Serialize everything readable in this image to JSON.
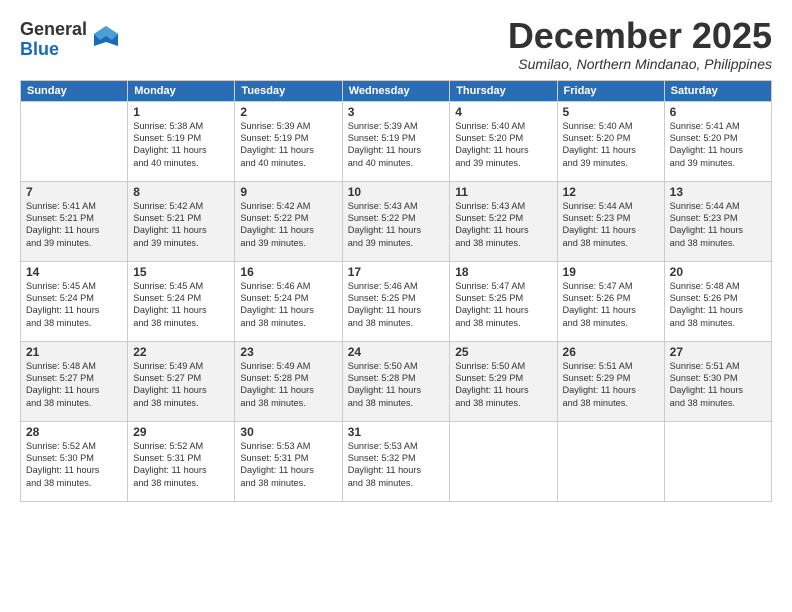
{
  "header": {
    "logo_line1": "General",
    "logo_line2": "Blue",
    "month": "December 2025",
    "location": "Sumilao, Northern Mindanao, Philippines"
  },
  "days_of_week": [
    "Sunday",
    "Monday",
    "Tuesday",
    "Wednesday",
    "Thursday",
    "Friday",
    "Saturday"
  ],
  "weeks": [
    [
      {
        "day": "",
        "info": ""
      },
      {
        "day": "1",
        "info": "Sunrise: 5:38 AM\nSunset: 5:19 PM\nDaylight: 11 hours\nand 40 minutes."
      },
      {
        "day": "2",
        "info": "Sunrise: 5:39 AM\nSunset: 5:19 PM\nDaylight: 11 hours\nand 40 minutes."
      },
      {
        "day": "3",
        "info": "Sunrise: 5:39 AM\nSunset: 5:19 PM\nDaylight: 11 hours\nand 40 minutes."
      },
      {
        "day": "4",
        "info": "Sunrise: 5:40 AM\nSunset: 5:20 PM\nDaylight: 11 hours\nand 39 minutes."
      },
      {
        "day": "5",
        "info": "Sunrise: 5:40 AM\nSunset: 5:20 PM\nDaylight: 11 hours\nand 39 minutes."
      },
      {
        "day": "6",
        "info": "Sunrise: 5:41 AM\nSunset: 5:20 PM\nDaylight: 11 hours\nand 39 minutes."
      }
    ],
    [
      {
        "day": "7",
        "info": "Sunrise: 5:41 AM\nSunset: 5:21 PM\nDaylight: 11 hours\nand 39 minutes."
      },
      {
        "day": "8",
        "info": "Sunrise: 5:42 AM\nSunset: 5:21 PM\nDaylight: 11 hours\nand 39 minutes."
      },
      {
        "day": "9",
        "info": "Sunrise: 5:42 AM\nSunset: 5:22 PM\nDaylight: 11 hours\nand 39 minutes."
      },
      {
        "day": "10",
        "info": "Sunrise: 5:43 AM\nSunset: 5:22 PM\nDaylight: 11 hours\nand 39 minutes."
      },
      {
        "day": "11",
        "info": "Sunrise: 5:43 AM\nSunset: 5:22 PM\nDaylight: 11 hours\nand 38 minutes."
      },
      {
        "day": "12",
        "info": "Sunrise: 5:44 AM\nSunset: 5:23 PM\nDaylight: 11 hours\nand 38 minutes."
      },
      {
        "day": "13",
        "info": "Sunrise: 5:44 AM\nSunset: 5:23 PM\nDaylight: 11 hours\nand 38 minutes."
      }
    ],
    [
      {
        "day": "14",
        "info": "Sunrise: 5:45 AM\nSunset: 5:24 PM\nDaylight: 11 hours\nand 38 minutes."
      },
      {
        "day": "15",
        "info": "Sunrise: 5:45 AM\nSunset: 5:24 PM\nDaylight: 11 hours\nand 38 minutes."
      },
      {
        "day": "16",
        "info": "Sunrise: 5:46 AM\nSunset: 5:24 PM\nDaylight: 11 hours\nand 38 minutes."
      },
      {
        "day": "17",
        "info": "Sunrise: 5:46 AM\nSunset: 5:25 PM\nDaylight: 11 hours\nand 38 minutes."
      },
      {
        "day": "18",
        "info": "Sunrise: 5:47 AM\nSunset: 5:25 PM\nDaylight: 11 hours\nand 38 minutes."
      },
      {
        "day": "19",
        "info": "Sunrise: 5:47 AM\nSunset: 5:26 PM\nDaylight: 11 hours\nand 38 minutes."
      },
      {
        "day": "20",
        "info": "Sunrise: 5:48 AM\nSunset: 5:26 PM\nDaylight: 11 hours\nand 38 minutes."
      }
    ],
    [
      {
        "day": "21",
        "info": "Sunrise: 5:48 AM\nSunset: 5:27 PM\nDaylight: 11 hours\nand 38 minutes."
      },
      {
        "day": "22",
        "info": "Sunrise: 5:49 AM\nSunset: 5:27 PM\nDaylight: 11 hours\nand 38 minutes."
      },
      {
        "day": "23",
        "info": "Sunrise: 5:49 AM\nSunset: 5:28 PM\nDaylight: 11 hours\nand 38 minutes."
      },
      {
        "day": "24",
        "info": "Sunrise: 5:50 AM\nSunset: 5:28 PM\nDaylight: 11 hours\nand 38 minutes."
      },
      {
        "day": "25",
        "info": "Sunrise: 5:50 AM\nSunset: 5:29 PM\nDaylight: 11 hours\nand 38 minutes."
      },
      {
        "day": "26",
        "info": "Sunrise: 5:51 AM\nSunset: 5:29 PM\nDaylight: 11 hours\nand 38 minutes."
      },
      {
        "day": "27",
        "info": "Sunrise: 5:51 AM\nSunset: 5:30 PM\nDaylight: 11 hours\nand 38 minutes."
      }
    ],
    [
      {
        "day": "28",
        "info": "Sunrise: 5:52 AM\nSunset: 5:30 PM\nDaylight: 11 hours\nand 38 minutes."
      },
      {
        "day": "29",
        "info": "Sunrise: 5:52 AM\nSunset: 5:31 PM\nDaylight: 11 hours\nand 38 minutes."
      },
      {
        "day": "30",
        "info": "Sunrise: 5:53 AM\nSunset: 5:31 PM\nDaylight: 11 hours\nand 38 minutes."
      },
      {
        "day": "31",
        "info": "Sunrise: 5:53 AM\nSunset: 5:32 PM\nDaylight: 11 hours\nand 38 minutes."
      },
      {
        "day": "",
        "info": ""
      },
      {
        "day": "",
        "info": ""
      },
      {
        "day": "",
        "info": ""
      }
    ]
  ]
}
